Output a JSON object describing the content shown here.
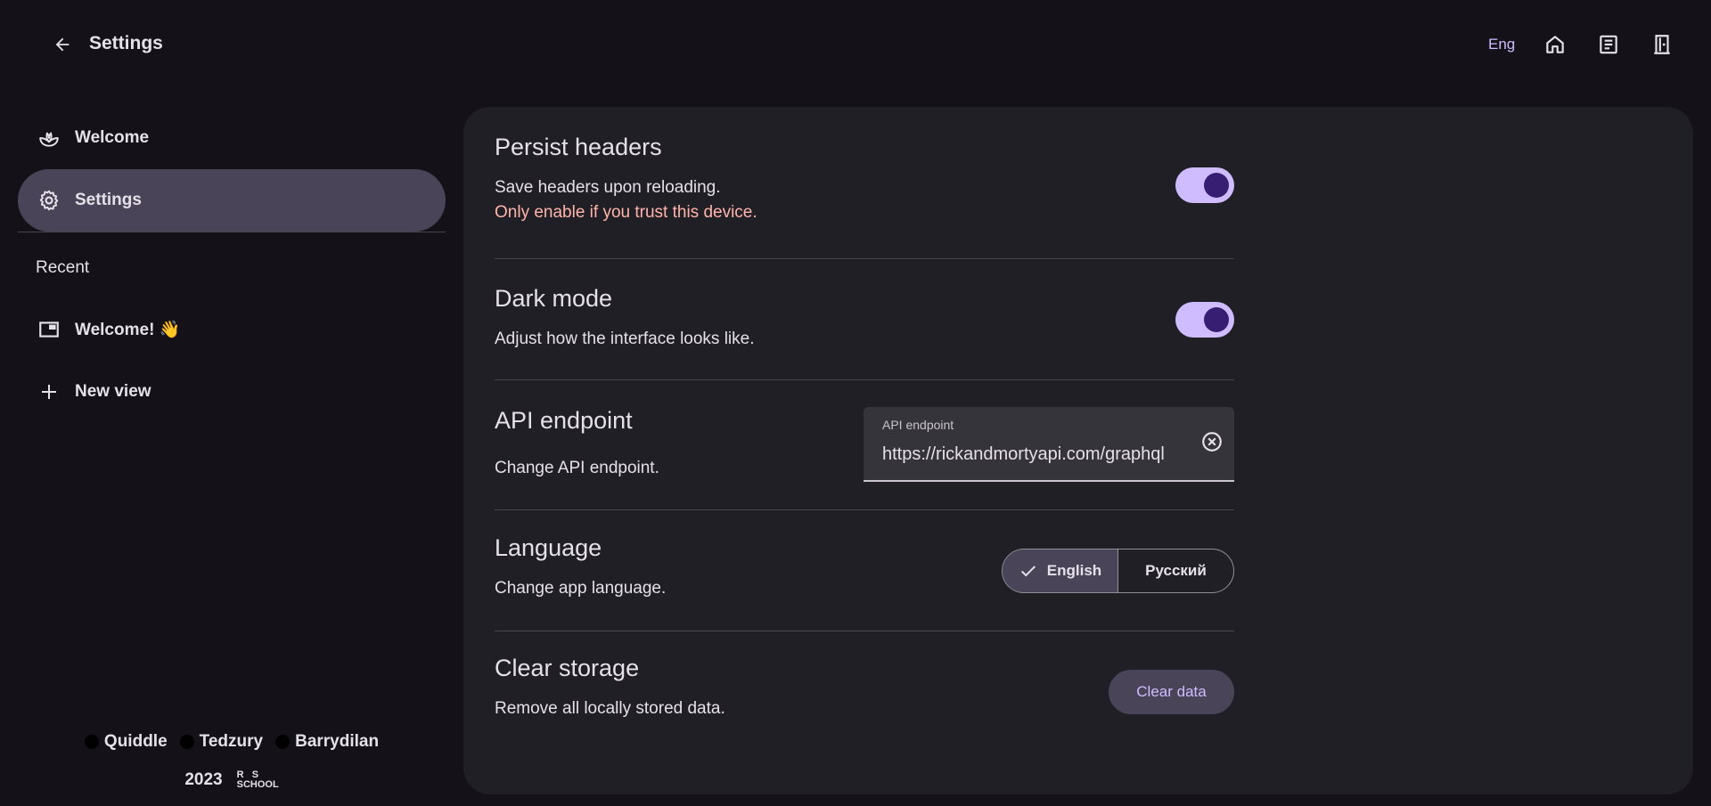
{
  "header": {
    "title": "Settings",
    "language_button": "Eng"
  },
  "sidebar": {
    "items": [
      {
        "label": "Welcome",
        "icon": "plant-icon"
      },
      {
        "label": "Settings",
        "icon": "gear-icon",
        "active": true
      }
    ],
    "recent_label": "Recent",
    "recent_items": [
      {
        "label": "Welcome! 👋",
        "icon": "window-icon"
      },
      {
        "label": "New view",
        "icon": "plus-icon"
      }
    ],
    "footer": {
      "authors": [
        "Quiddle",
        "Tedzury",
        "Barrydilan"
      ],
      "year": "2023",
      "logo_text": "RS SCHOOL"
    }
  },
  "settings": {
    "persist_headers": {
      "title": "Persist headers",
      "description": "Save headers upon reloading.",
      "warning": "Only enable if you trust this device.",
      "enabled": true
    },
    "dark_mode": {
      "title": "Dark mode",
      "description": "Adjust how the interface looks like.",
      "enabled": true
    },
    "api_endpoint": {
      "title": "API endpoint",
      "description": "Change API endpoint.",
      "field_label": "API endpoint",
      "field_value": "https://rickandmortyapi.com/graphql"
    },
    "language": {
      "title": "Language",
      "description": "Change app language.",
      "options": [
        "English",
        "Русский"
      ],
      "selected": "English"
    },
    "clear_storage": {
      "title": "Clear storage",
      "description": "Remove all locally stored data.",
      "button_label": "Clear data"
    }
  },
  "colors": {
    "background": "#141218",
    "panel": "#211f26",
    "accent": "#cfbcff",
    "warning": "#ffb4ab"
  }
}
